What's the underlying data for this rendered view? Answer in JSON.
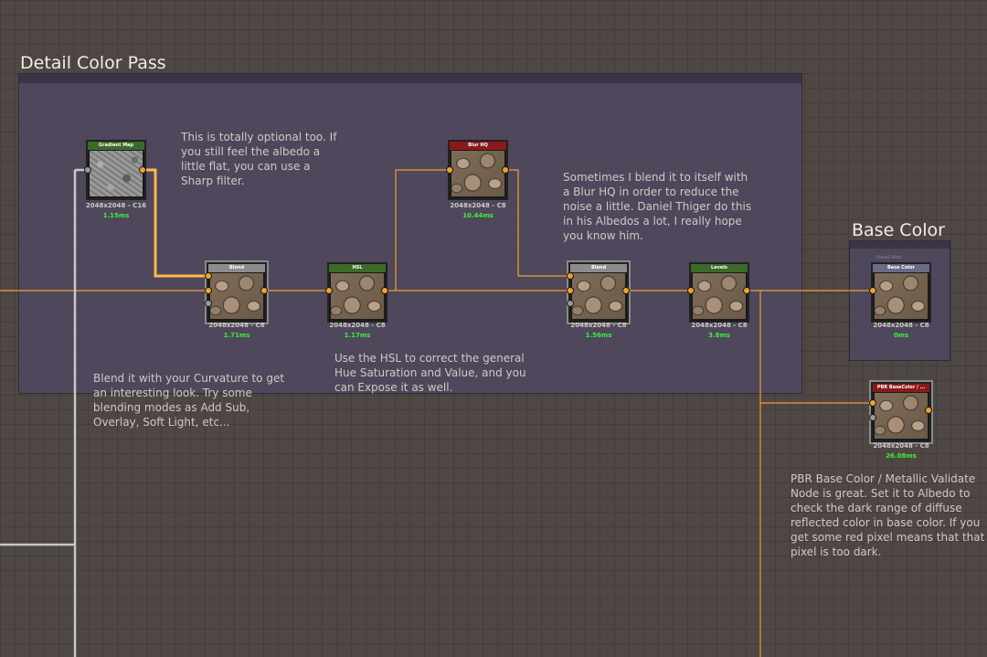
{
  "frames": {
    "detail": {
      "title": "Detail Color Pass"
    },
    "base": {
      "title": "Base Color"
    }
  },
  "nodes": {
    "gradient_map": {
      "title": "Gradient Map",
      "resolution": "2048x2048 - C16",
      "time": "1.15ms",
      "header_color": "#3b6a2a"
    },
    "blend1": {
      "title": "Blend",
      "resolution": "2048x2048 - C8",
      "time": "1.71ms",
      "header_color": "#8c8c8c"
    },
    "hsl": {
      "title": "HSL",
      "resolution": "2048x2048 - C8",
      "time": "1.17ms",
      "header_color": "#3b6a2a"
    },
    "blur_hq": {
      "title": "Blur HQ",
      "resolution": "2048x2048 - C8",
      "time": "10.44ms",
      "header_color": "#8a1a1a"
    },
    "blend2": {
      "title": "Blend",
      "resolution": "2048x2048 - C8",
      "time": "1.56ms",
      "header_color": "#8c8c8c"
    },
    "levels": {
      "title": "Levels",
      "resolution": "2048x2048 - C8",
      "time": "3.8ms",
      "header_color": "#3b6a2a"
    },
    "base_color": {
      "title": "Base Color",
      "subtitle": "(baseColor)",
      "resolution": "2048x2048 - C8",
      "time": "0ms",
      "header_color": "#6a6a88"
    },
    "pbr_validate": {
      "title": "PBR BaseColor / ...",
      "resolution": "2048x2048 - C8",
      "time": "26.08ms",
      "header_color": "#8a1a1a"
    }
  },
  "comments": {
    "optional": "This is totally optional too. If\nyou still feel the albedo a\nlittle flat, you can use a\nSharp filter.",
    "blur": "Sometimes I blend it to itself with\na Blur HQ in order to reduce the\nnoise a little. Daniel Thiger do this\nin his Albedos a lot, I really hope\nyou know him.",
    "blend": "Blend it with your Curvature to get\nan interesting look. Try some\nblending modes as Add Sub,\nOverlay, Soft Light, etc...",
    "hsl": "Use the HSL to correct the general\nHue Saturation and Value, and you\ncan Expose it as well.",
    "pbr": "PBR Base Color / Metallic Validate\nNode is great. Set it to Albedo to\ncheck the dark range of diffuse\nreflected color in base color. If you\nget some red pixel means that that\npixel is too dark."
  },
  "colors": {
    "wire": "#f0a030",
    "wire_selected": "#ffb84a",
    "wire_gray": "#c8c8c8",
    "frame_bg": "#504864",
    "canvas_bg": "#4e4744"
  }
}
